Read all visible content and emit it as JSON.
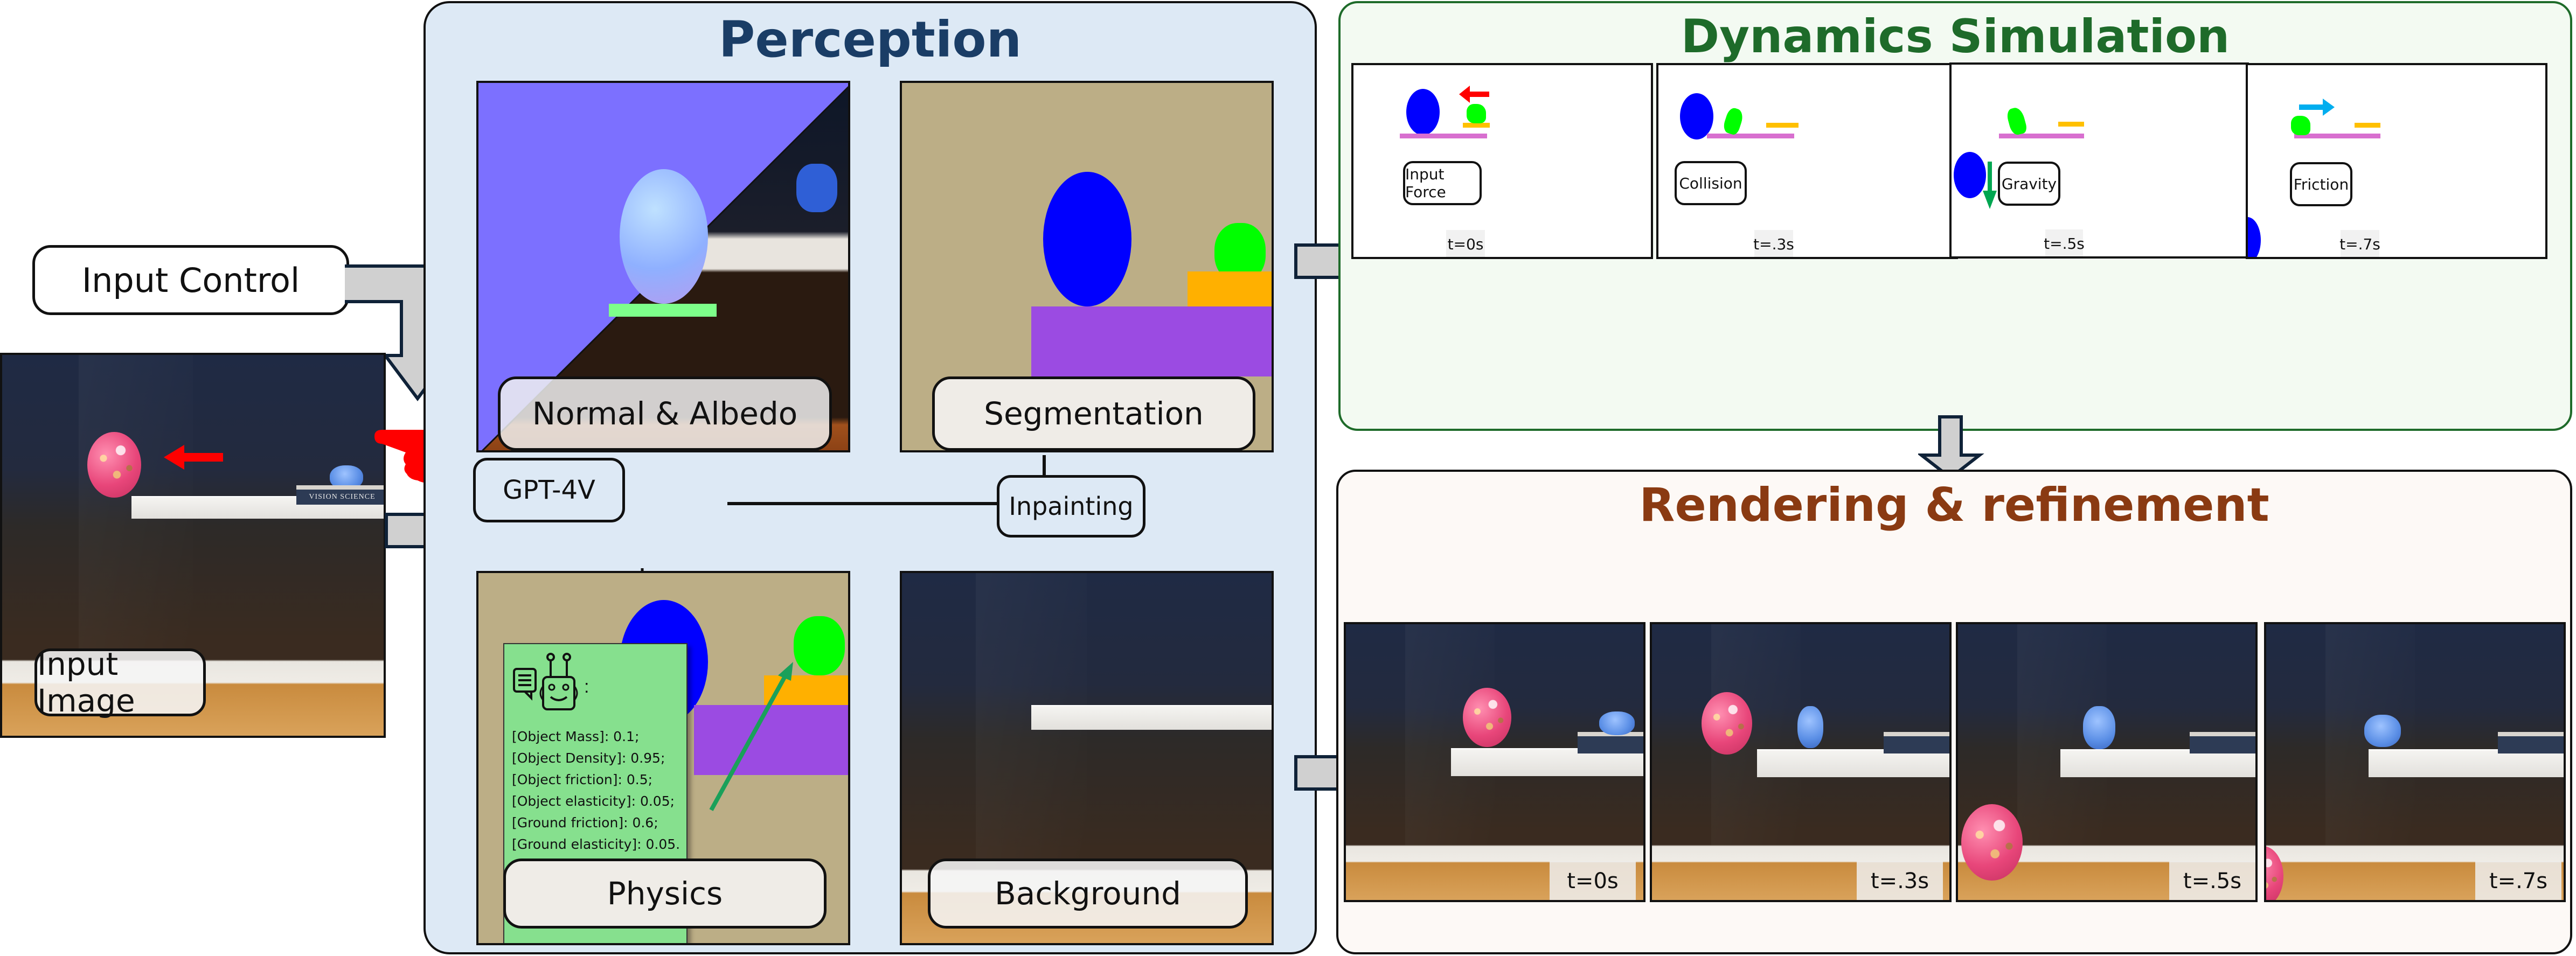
{
  "input": {
    "control_label": "Input Control",
    "image_label": "Input Image",
    "book_text": "VISION SCIENCE"
  },
  "perception": {
    "title": "Perception",
    "title_color": "#1a3d66",
    "panel_bg": "#dde9f5",
    "normal_albedo_label": "Normal & Albedo",
    "segmentation_label": "Segmentation",
    "gpt_label": "GPT-4V",
    "inpainting_label": "Inpainting",
    "physics_label": "Physics",
    "background_label": "Background",
    "physics_params": [
      "[Object Mass]: 0.1;",
      "[Object Density]: 0.95;",
      "[Object friction]: 0.5;",
      "[Object elasticity]: 0.05;",
      "[Ground friction]: 0.6;",
      "[Ground elasticity]: 0.05."
    ],
    "physics_colon": ":"
  },
  "dynamics": {
    "title": "Dynamics Simulation",
    "title_color": "#1e6b2a",
    "panel_bg": "#f3faf2",
    "frames": [
      {
        "label": "Input Force",
        "time": "t=0s"
      },
      {
        "label": "Collision",
        "time": "t=.3s"
      },
      {
        "label": "Gravity",
        "time": "t=.5s"
      },
      {
        "label": "Friction",
        "time": "t=.7s"
      }
    ]
  },
  "rendering": {
    "title": "Rendering & refinement",
    "title_color": "#8a3a12",
    "panel_bg": "#fdf9f6",
    "frames": [
      {
        "time": "t=0s"
      },
      {
        "time": "t=.3s"
      },
      {
        "time": "t=.5s"
      },
      {
        "time": "t=.7s"
      }
    ]
  },
  "colors": {
    "arrow_fill": "#d0d0d0",
    "arrow_stroke": "#0f2238",
    "force_red": "#ff0000",
    "gravity_green": "#00a651",
    "friction_blue": "#00aeef",
    "seg_bg": "#bcae86",
    "seg_blue": "#0000ff",
    "seg_green": "#00ff00",
    "seg_orange": "#ffb000",
    "seg_purple": "#9b4be2",
    "normal_bg": "#7c70ff",
    "physics_card_bg": "#86e08e"
  }
}
